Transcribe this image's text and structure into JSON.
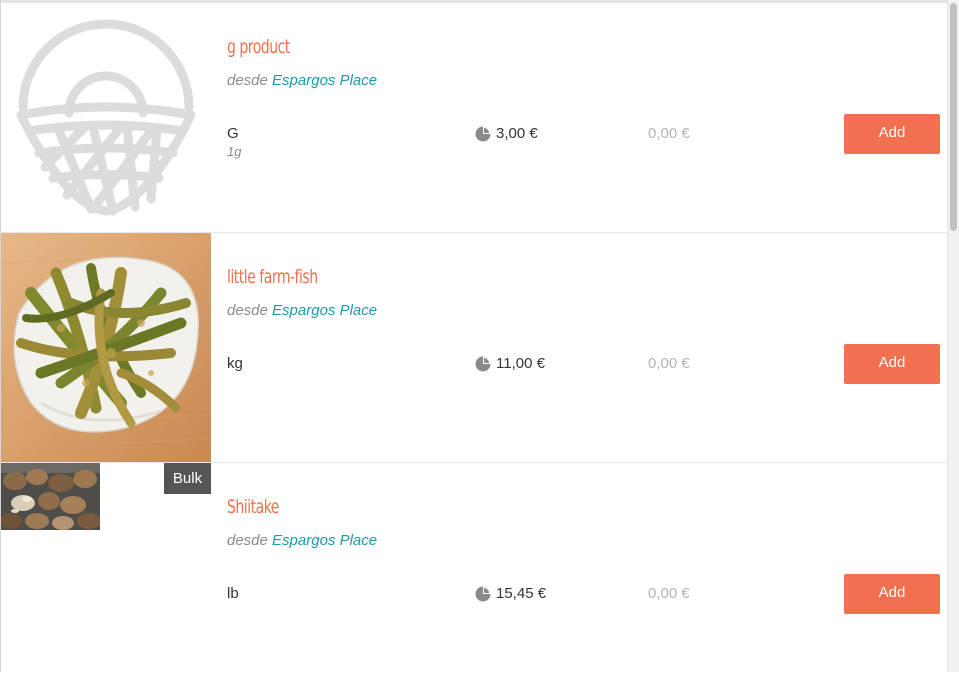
{
  "products": [
    {
      "title": "g product",
      "source_prefix": "desde",
      "source_name": "Espargos Place",
      "unit": "G",
      "subunit": "1g",
      "price": "3,00 €",
      "total": "0,00 €",
      "add_label": "Add",
      "image": "placeholder-basket-icon",
      "badge": ""
    },
    {
      "title": "little farm-fish",
      "source_prefix": "desde",
      "source_name": "Espargos Place",
      "unit": "kg",
      "subunit": "",
      "price": "11,00 €",
      "total": "0,00 €",
      "add_label": "Add",
      "image": "fried-green-beans-photo",
      "badge": ""
    },
    {
      "title": "Shiitake",
      "source_prefix": "desde",
      "source_name": "Espargos Place",
      "unit": "lb",
      "subunit": "",
      "price": "15,45 €",
      "total": "0,00 €",
      "add_label": "Add",
      "image": "shiitake-mushrooms-photo",
      "badge": "Bulk"
    }
  ],
  "colors": {
    "accent": "#f07050",
    "title": "#ef6f4e",
    "link": "#1b9aaa",
    "muted": "#8c8c8c",
    "badge_bg": "#555555"
  }
}
